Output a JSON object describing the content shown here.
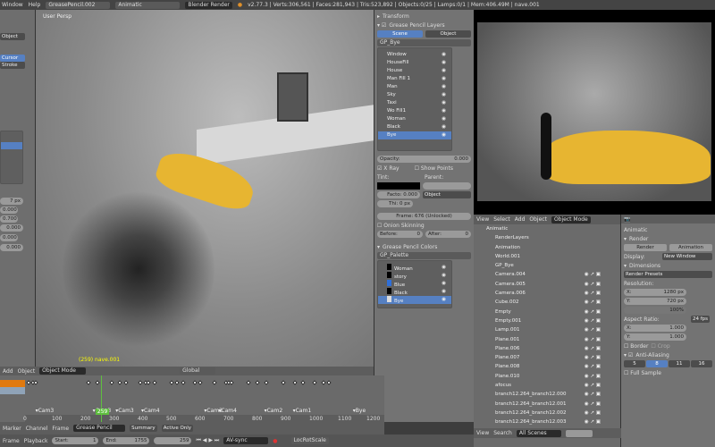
{
  "topbar": {
    "menus": [
      "Window",
      "Help"
    ],
    "screen": "GreasePencil.002",
    "scene": "Animatic",
    "engine": "Blender Render",
    "stats": "v2.77.3 | Verts:306,561 | Faces:281,943 | Tris:523,892 | Objects:0/25 | Lamps:0/1 | Mem:406.49M | nave.001"
  },
  "shelf": {
    "object_btn": "Object",
    "cursor": "Cursor",
    "stroke": "Stroke",
    "values": [
      "7 px",
      "0.000",
      "0.700",
      "0.000",
      "0.000",
      "0.000"
    ]
  },
  "viewport": {
    "label": "User Persp",
    "object_label": "(259) nave.001",
    "header": {
      "menus": [
        "Add",
        "Object"
      ],
      "mode": "Object Mode",
      "orientation": "Global"
    }
  },
  "gp_panel": {
    "transform": "Transform",
    "layers_title": "Grease Pencil Layers",
    "tabs": [
      "Scene",
      "Object"
    ],
    "datablock": "GP_Bye",
    "layers": [
      "Window",
      "HouseFill",
      "House",
      "Man Fill 1",
      "Man",
      "Sky",
      "Taxi",
      "Wo Fill1",
      "Woman",
      "Black",
      "Bye"
    ],
    "selected_layer": "Bye",
    "opacity_label": "Opacity:",
    "opacity": "0.000",
    "xray": "X Ray",
    "show_points": "Show Points",
    "tint": "Tint:",
    "parent": "Parent:",
    "factor": "Facto: 0.000",
    "thickness": "Thi: 0 px",
    "parent_type": "Object",
    "frame": "Frame: 676 (Unlocked)",
    "onion": "Onion Skinning",
    "before": "Before:",
    "before_val": "0",
    "after": "After:",
    "after_val": "0",
    "colors_title": "Grease Pencil Colors",
    "palette": "GP_Palette",
    "colors": [
      {
        "name": "Woman",
        "swatch": "#000000"
      },
      {
        "name": "story",
        "swatch": "#000000"
      },
      {
        "name": "Blue",
        "swatch": "#2f6fd8"
      },
      {
        "name": "Black",
        "swatch": "#000000"
      },
      {
        "name": "Bye",
        "swatch": "#dddddd"
      }
    ],
    "selected_color": "Bye"
  },
  "outliner": {
    "header": [
      "View",
      "Select",
      "Add",
      "Object"
    ],
    "mode": "Object Mode",
    "items": [
      "Animatic",
      "RenderLayers",
      "Animation",
      "World.001",
      "GP_Bye",
      "Camera.004",
      "Camera.005",
      "Camera.006",
      "Cube.002",
      "Empty",
      "Empty.001",
      "Lamp.001",
      "Plane.001",
      "Plane.006",
      "Plane.007",
      "Plane.008",
      "Plane.010",
      "afocus",
      "branch12.264_branch12.000",
      "branch12.264_branch12.001",
      "branch12.264_branch12.002",
      "branch12.264_branch12.003"
    ],
    "footer": [
      "View",
      "Search"
    ],
    "filter": "All Scenes"
  },
  "props": {
    "scene": "Animatic",
    "render_section": "Render",
    "render_btn": "Render",
    "animation_btn": "Animation",
    "display_label": "Display:",
    "display": "New Window",
    "dimensions": "Dimensions",
    "presets": "Render Presets",
    "resolution": "Resolution:",
    "res_x": "1280 px",
    "res_y": "720 px",
    "res_pct": "100%",
    "aspect": "Aspect Ratio:",
    "asp_x": "1.000",
    "asp_y": "1.000",
    "border": "Border",
    "crop": "Crop",
    "fps": "24 fps",
    "aa": "Anti-Aliasing",
    "aa_samples": [
      "5",
      "8",
      "11",
      "16"
    ],
    "aa_selected": "8",
    "full_sample": "Full Sample"
  },
  "timeline": {
    "markers": [
      {
        "name": "Cam3",
        "frame": 30
      },
      {
        "name": "Cam3",
        "frame": 230
      },
      {
        "name": "Cam3",
        "frame": 310
      },
      {
        "name": "Cam4",
        "frame": 400
      },
      {
        "name": "Cam2",
        "frame": 620
      },
      {
        "name": "Cam4",
        "frame": 670
      },
      {
        "name": "Cam2",
        "frame": 830
      },
      {
        "name": "Cam1",
        "frame": 930
      },
      {
        "name": "Bye",
        "frame": 1140
      }
    ],
    "ticks": [
      "0",
      "100",
      "200",
      "300",
      "400",
      "500",
      "600",
      "700",
      "800",
      "900",
      "1000",
      "1100",
      "1200"
    ],
    "current": "259",
    "current_frame": 259,
    "menus": [
      "Marker",
      "Channel",
      "Frame"
    ],
    "mode": "Grease Pencil",
    "summary": "Summary",
    "active_only": "Active Only",
    "playback": [
      "Frame",
      "Playback"
    ],
    "start": "Start:",
    "start_val": "1",
    "end": "End:",
    "end_val": "1755",
    "frame_val": "259",
    "sync": "AV-sync",
    "keying": "LocRotScale"
  },
  "colors": {
    "accent": "#5680c2",
    "taxi": "#e7b531",
    "playhead": "#5fbf3f"
  }
}
